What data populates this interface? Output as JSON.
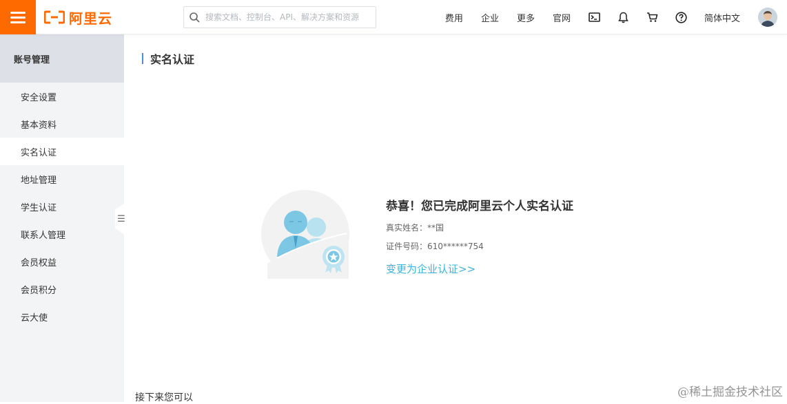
{
  "header": {
    "brand": "阿里云",
    "search_placeholder": "搜索文档、控制台、API、解决方案和资源",
    "nav": [
      "费用",
      "企业",
      "更多",
      "官网"
    ],
    "icons": [
      "terminal-icon",
      "bell-icon",
      "cart-icon",
      "help-icon"
    ],
    "language": "简体中文"
  },
  "sidebar": {
    "title": "账号管理",
    "items": [
      {
        "label": "安全设置",
        "active": false
      },
      {
        "label": "基本资料",
        "active": false
      },
      {
        "label": "实名认证",
        "active": true
      },
      {
        "label": "地址管理",
        "active": false
      },
      {
        "label": "学生认证",
        "active": false
      },
      {
        "label": "联系人管理",
        "active": false
      },
      {
        "label": "会员权益",
        "active": false
      },
      {
        "label": "会员积分",
        "active": false
      },
      {
        "label": "云大使",
        "active": false
      }
    ],
    "collapse_glyph": "☰"
  },
  "main": {
    "title": "实名认证",
    "success": {
      "headline": "恭喜！您已完成阿里云个人实名认证",
      "name_row": "真实姓名：**国",
      "id_row": "证件号码：610******754",
      "link": "变更为企业认证>>"
    },
    "next_heading": "接下来您可以"
  },
  "watermark": "@稀土掘金技术社区",
  "colors": {
    "brand": "#ff6a00",
    "link": "#3fb2d8",
    "title_bar": "#4a90d9",
    "sidebar_bg": "#f3f4f6",
    "sidebar_head_bg": "#dde0e6"
  }
}
